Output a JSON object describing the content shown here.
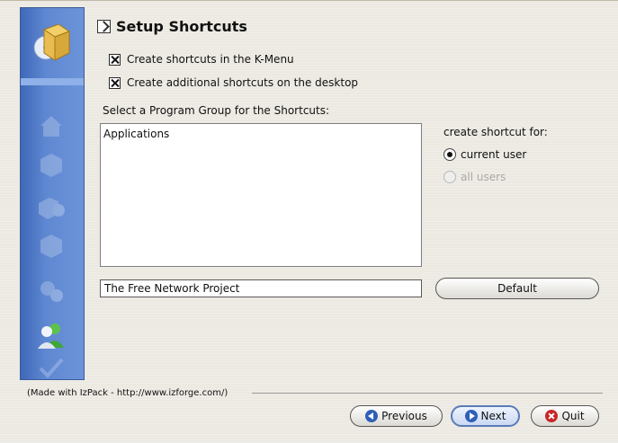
{
  "panel": {
    "title": "Setup Shortcuts",
    "title_icon": "shortcut-arrow-icon"
  },
  "sidebar": {
    "logo_icon": "installer-box-icon",
    "steps": [
      {
        "icon": "home-icon",
        "active": false
      },
      {
        "icon": "package-icon",
        "active": false
      },
      {
        "icon": "packs-icon",
        "active": false
      },
      {
        "icon": "box-icon",
        "active": false
      },
      {
        "icon": "gears-icon",
        "active": false
      },
      {
        "icon": "users-icon",
        "active": true
      },
      {
        "icon": "checkmark-icon",
        "active": false
      }
    ]
  },
  "options": {
    "kmenu_label": "Create shortcuts in the K-Menu",
    "kmenu_checked": true,
    "desktop_label": "Create additional shortcuts on the desktop",
    "desktop_checked": true
  },
  "program_group": {
    "label": "Select a Program Group for the Shortcuts:",
    "items": [
      "Applications"
    ],
    "value": "The Free Network Project",
    "default_button": "Default"
  },
  "create_for": {
    "label": "create shortcut for:",
    "current_user": "current user",
    "all_users": "all users",
    "selected": "current user"
  },
  "footer": {
    "made_with": "(Made with IzPack - http://www.izforge.com/)",
    "previous": "Previous",
    "next": "Next",
    "quit": "Quit"
  }
}
